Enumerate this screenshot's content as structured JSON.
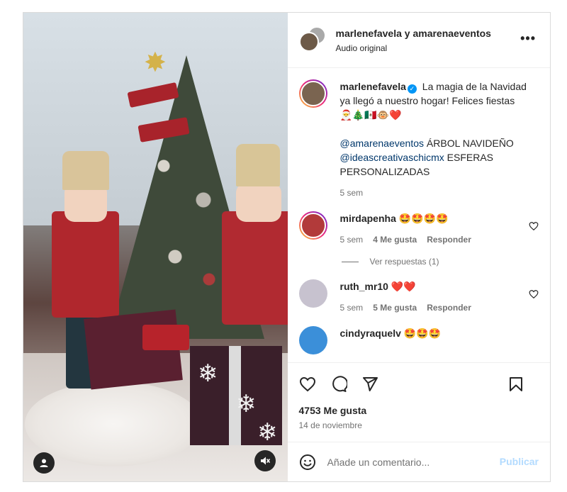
{
  "post": {
    "header": {
      "names": "marlenefavela y amarenaeventos",
      "audio": "Audio original",
      "more_icon": "more-horizontal-icon"
    },
    "caption": {
      "username": "marlenefavela",
      "text_line1": "La magia de la Navidad ya llegó a nuestro hogar! Felices fiestas",
      "emojis": "🎅🎄🇲🇽🐵❤️",
      "mention1": "@amarenaeventos",
      "mention1_text": " ÁRBOL NAVIDEÑO",
      "mention2": "@ideascreativaschicmx",
      "mention2_text": " ESFERAS PERSONALIZADAS",
      "time": "5 sem"
    },
    "comments": [
      {
        "username": "mirdapenha",
        "text": "🤩🤩🤩🤩",
        "time": "5 sem",
        "likes": "4 Me gusta",
        "reply": "Responder",
        "view_replies": "Ver respuestas (1)"
      },
      {
        "username": "ruth_mr10",
        "text": "❤️❤️",
        "time": "5 sem",
        "likes": "5 Me gusta",
        "reply": "Responder"
      },
      {
        "username": "cindyraquelv",
        "text": "🤩🤩🤩"
      }
    ],
    "likes_count": "4753 Me gusta",
    "date": "14 de noviembre",
    "add_comment_placeholder": "Añade un comentario...",
    "publish_label": "Publicar",
    "colors": {
      "link": "#00376b",
      "publish_disabled": "#b3dbff",
      "verified": "#0095f6"
    }
  }
}
